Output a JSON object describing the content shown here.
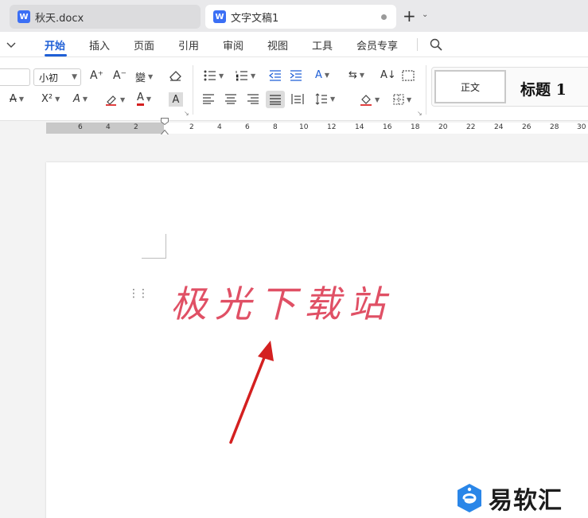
{
  "tabs": {
    "inactive": {
      "badge": "W",
      "title": "秋天.docx"
    },
    "active": {
      "badge": "W",
      "title": "文字文稿1"
    },
    "new_tab": "+"
  },
  "menu": {
    "items": [
      "开始",
      "插入",
      "页面",
      "引用",
      "审阅",
      "视图",
      "工具",
      "会员专享"
    ],
    "active": "开始"
  },
  "ribbon": {
    "font_size": "小初",
    "styles": {
      "normal": "正文",
      "heading1": "标题 1"
    }
  },
  "ruler": {
    "left_labels": [
      "6",
      "4",
      "2"
    ],
    "right_labels": [
      "2",
      "4",
      "6",
      "8",
      "10",
      "12",
      "14",
      "16",
      "18",
      "20",
      "22",
      "24",
      "26",
      "28",
      "30"
    ]
  },
  "document": {
    "text": "极光下载站"
  },
  "watermark": {
    "text": "易软汇"
  },
  "colors": {
    "accent": "#1f5fd6",
    "doc_text": "#e05065",
    "arrow": "#d42020"
  }
}
